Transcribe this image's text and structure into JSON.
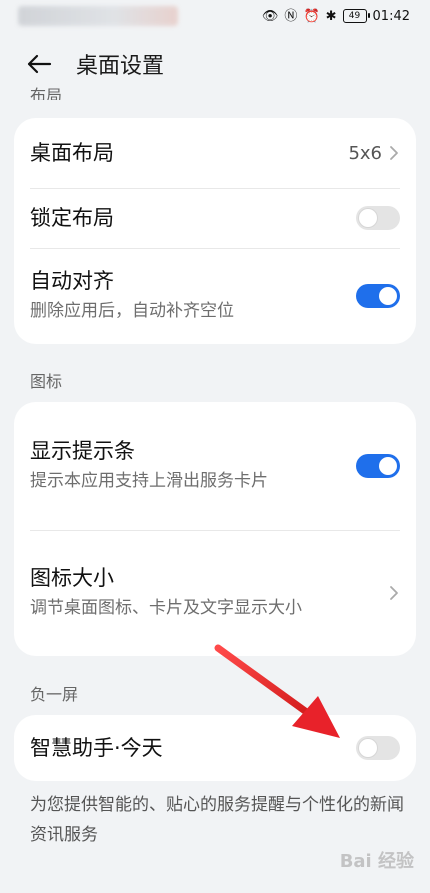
{
  "status_bar": {
    "time": "01:42",
    "battery": "49",
    "icons": [
      "eye-icon",
      "nfc-icon",
      "alarm-icon",
      "bluetooth-icon"
    ]
  },
  "header": {
    "title": "桌面设置"
  },
  "sections": {
    "layout": {
      "label": "布局"
    },
    "icons": {
      "label": "图标"
    },
    "minus_screen": {
      "label": "负一屏"
    }
  },
  "layout_card": {
    "desktop_layout": {
      "title": "桌面布局",
      "value": "5x6"
    },
    "lock_layout": {
      "title": "锁定布局",
      "enabled": false
    },
    "auto_align": {
      "title": "自动对齐",
      "subtitle": "删除应用后，自动补齐空位",
      "enabled": true
    }
  },
  "icons_card": {
    "show_hint": {
      "title": "显示提示条",
      "subtitle": "提示本应用支持上滑出服务卡片",
      "enabled": true
    },
    "icon_size": {
      "title": "图标大小",
      "subtitle": "调节桌面图标、卡片及文字显示大小"
    }
  },
  "minus_card": {
    "assistant": {
      "title": "智慧助手·今天",
      "enabled": false
    }
  },
  "footer": {
    "description": "为您提供智能的、贴心的服务提醒与个性化的新闻资讯服务"
  },
  "watermark": {
    "text": "Bai 经验"
  },
  "colors": {
    "accent": "#1f6feb",
    "arrow": "#e8222a"
  }
}
